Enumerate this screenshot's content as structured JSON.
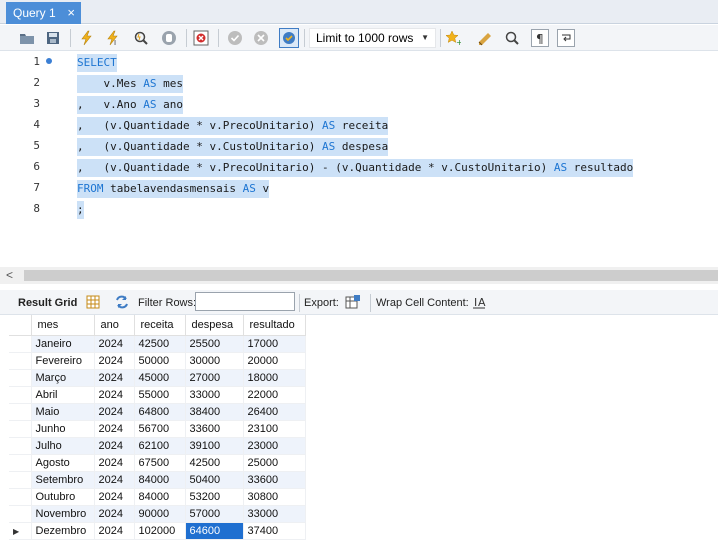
{
  "tab": {
    "label": "Query 1",
    "close": "×"
  },
  "toolbar": {
    "limit_label": "Limit to 1000 rows",
    "icons": [
      "folder-open-icon",
      "save-icon",
      "execute-icon",
      "execute-statement-icon",
      "explain-icon",
      "stop-icon",
      "toggle-error-icon",
      "commit-icon",
      "rollback-icon",
      "autocommit-icon",
      "beautify-icon",
      "find-icon",
      "invisible-chars-icon",
      "wrap-icon"
    ]
  },
  "editor": {
    "line_numbers": [
      "1",
      "2",
      "3",
      "4",
      "5",
      "6",
      "7",
      "8"
    ],
    "lines": [
      [
        {
          "t": "SELECT",
          "k": true
        }
      ],
      [
        {
          "t": "    v.Mes ",
          "k": false
        },
        {
          "t": "AS",
          "k": true
        },
        {
          "t": " mes",
          "k": false
        }
      ],
      [
        {
          "t": ",   v.Ano ",
          "k": false
        },
        {
          "t": "AS",
          "k": true
        },
        {
          "t": " ano",
          "k": false
        }
      ],
      [
        {
          "t": ",   (v.Quantidade * v.PrecoUnitario) ",
          "k": false
        },
        {
          "t": "AS",
          "k": true
        },
        {
          "t": " receita",
          "k": false
        }
      ],
      [
        {
          "t": ",   (v.Quantidade * v.CustoUnitario) ",
          "k": false
        },
        {
          "t": "AS",
          "k": true
        },
        {
          "t": " despesa",
          "k": false
        }
      ],
      [
        {
          "t": ",   (v.Quantidade * v.PrecoUnitario) - (v.Quantidade * v.CustoUnitario) ",
          "k": false
        },
        {
          "t": "AS",
          "k": true
        },
        {
          "t": " resultado",
          "k": false
        }
      ],
      [
        {
          "t": "FROM",
          "k": true
        },
        {
          "t": " tabelavendasmensais ",
          "k": false
        },
        {
          "t": "AS",
          "k": true
        },
        {
          "t": " v",
          "k": false
        }
      ],
      [
        {
          "t": ";",
          "k": false
        }
      ]
    ]
  },
  "scroll": {
    "left_arrow": "<"
  },
  "results": {
    "result_grid_label": "Result Grid",
    "filter_label": "Filter Rows:",
    "filter_value": "",
    "export_label": "Export:",
    "wrap_label": "Wrap Cell Content:",
    "columns": [
      "mes",
      "ano",
      "receita",
      "despesa",
      "resultado"
    ],
    "rows": [
      [
        "Janeiro",
        "2024",
        "42500",
        "25500",
        "17000"
      ],
      [
        "Fevereiro",
        "2024",
        "50000",
        "30000",
        "20000"
      ],
      [
        "Março",
        "2024",
        "45000",
        "27000",
        "18000"
      ],
      [
        "Abril",
        "2024",
        "55000",
        "33000",
        "22000"
      ],
      [
        "Maio",
        "2024",
        "64800",
        "38400",
        "26400"
      ],
      [
        "Junho",
        "2024",
        "56700",
        "33600",
        "23100"
      ],
      [
        "Julho",
        "2024",
        "62100",
        "39100",
        "23000"
      ],
      [
        "Agosto",
        "2024",
        "67500",
        "42500",
        "25000"
      ],
      [
        "Setembro",
        "2024",
        "84000",
        "50400",
        "33600"
      ],
      [
        "Outubro",
        "2024",
        "84000",
        "53200",
        "30800"
      ],
      [
        "Novembro",
        "2024",
        "90000",
        "57000",
        "33000"
      ],
      [
        "Dezembro",
        "2024",
        "102000",
        "64600",
        "37400"
      ]
    ],
    "selected_cell": {
      "row": 11,
      "col": 3
    },
    "current_row_marker": "▶"
  }
}
